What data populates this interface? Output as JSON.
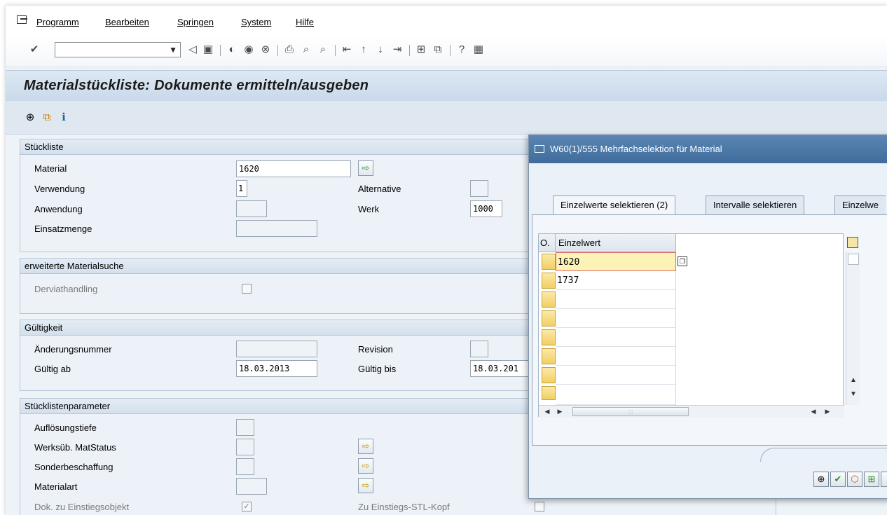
{
  "menu": {
    "items": [
      {
        "label": "Programm"
      },
      {
        "label": "Bearbeiten"
      },
      {
        "label": "Springen"
      },
      {
        "label": "System"
      },
      {
        "label": "Hilfe"
      }
    ]
  },
  "toolbar": {
    "okcode_value": ""
  },
  "page": {
    "title": "Materialstückliste: Dokumente ermitteln/ausgeben"
  },
  "stueckliste": {
    "title": "Stückliste",
    "material_label": "Material",
    "material_value": "1620",
    "verwendung_label": "Verwendung",
    "verwendung_value": "1",
    "alternative_label": "Alternative",
    "alternative_value": "",
    "anwendung_label": "Anwendung",
    "anwendung_value": "",
    "werk_label": "Werk",
    "werk_value": "1000",
    "einsatzmenge_label": "Einsatzmenge",
    "einsatzmenge_value": ""
  },
  "materialsuche": {
    "title": "erweiterte Materialsuche",
    "derviat_label": "Derviathandling",
    "derviat_checked": false
  },
  "gueltigkeit": {
    "title": "Gültigkeit",
    "aenderung_label": "Änderungsnummer",
    "aenderung_value": "",
    "revision_label": "Revision",
    "revision_value": "",
    "gueltig_ab_label": "Gültig ab",
    "gueltig_ab_value": "18.03.2013",
    "gueltig_bis_label": "Gültig bis",
    "gueltig_bis_value": "18.03.201"
  },
  "parameter": {
    "title": "Stücklistenparameter",
    "aufloesung_label": "Auflösungstiefe",
    "werks_label": "Werksüb. MatStatus",
    "sonder_label": "Sonderbeschaffung",
    "materialart_label": "Materialart",
    "dok_label": "Dok. zu Einstiegsobjekt",
    "dok_checked": true,
    "zu_label": "Zu Einstiegs-STL-Kopf",
    "zu_checked": false
  },
  "dialog": {
    "title": "W60(1)/555 Mehrfachselektion für Material",
    "tabs": [
      {
        "label": "Einzelwerte selektieren (2)",
        "active": true
      },
      {
        "label": "Intervalle selektieren",
        "active": false
      },
      {
        "label": "Einzelwe",
        "active": false
      }
    ],
    "grid_header_o": "O.",
    "grid_header_value": "Einzelwert",
    "rows": [
      "1620",
      "1737",
      "",
      "",
      "",
      "",
      "",
      ""
    ]
  }
}
